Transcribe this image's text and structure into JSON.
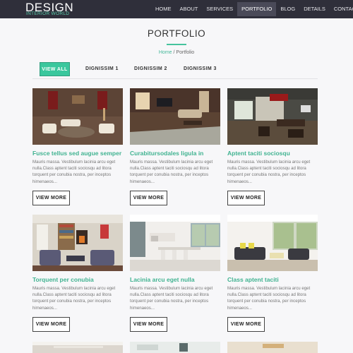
{
  "brand": {
    "name": "DESIGN",
    "tagline": "INTERIOR WORLD"
  },
  "nav": {
    "items": [
      "HOME",
      "ABOUT",
      "SERVICES",
      "PORTFOLIO",
      "BLOG",
      "DETAILS",
      "CONTACT"
    ],
    "active": "PORTFOLIO"
  },
  "page": {
    "title": "PORTFOLIO"
  },
  "breadcrumb": {
    "home": "Home",
    "separator": "/",
    "current": "Portfolio"
  },
  "filters": [
    "VIEW ALL",
    "DIGNISSIM 1",
    "DIGNISSIM 2",
    "DIGNISSIM 3"
  ],
  "cards": [
    {
      "title": "Fusce tellus sed augue semper",
      "desc": "Mauris massa. Vestibulum lacinia arcu eget nulla.Class aptent taciti sociosqu ad litora torquent per conubia nostra, per inceptos himenaeos...",
      "button": "VIEW MORE"
    },
    {
      "title": "Curabitursodales ligula in",
      "desc": "Mauris massa. Vestibulum lacinia arcu eget nulla.Class aptent taciti sociosqu ad litora torquent per conubia nostra, per inceptos himenaeos...",
      "button": "VIEW MORE"
    },
    {
      "title": "Aptent taciti sociosqu",
      "desc": "Mauris massa. Vestibulum lacinia arcu eget nulla.Class aptent taciti sociosqu ad litora torquent per conubia nostra, per inceptos himenaeos...",
      "button": "VIEW MORE"
    },
    {
      "title": "Torquent per conubia",
      "desc": "Mauris massa. Vestibulum lacinia arcu eget nulla.Class aptent taciti sociosqu ad litora torquent per conubia nostra, per inceptos himenaeos...",
      "button": "VIEW MORE"
    },
    {
      "title": "Lacinia arcu eget nulla",
      "desc": "Mauris massa. Vestibulum lacinia arcu eget nulla.Class aptent taciti sociosqu ad litora torquent per conubia nostra, per inceptos himenaeos...",
      "button": "VIEW MORE"
    },
    {
      "title": "Class aptent taciti",
      "desc": "Mauris massa. Vestibulum lacinia arcu eget nulla.Class aptent taciti sociosqu ad litora torquent per conubia nostra, per inceptos himenaeos...",
      "button": "VIEW MORE"
    }
  ],
  "colors": {
    "header": "#2f2f3a",
    "accent": "#46c39d",
    "link": "#41b391"
  }
}
